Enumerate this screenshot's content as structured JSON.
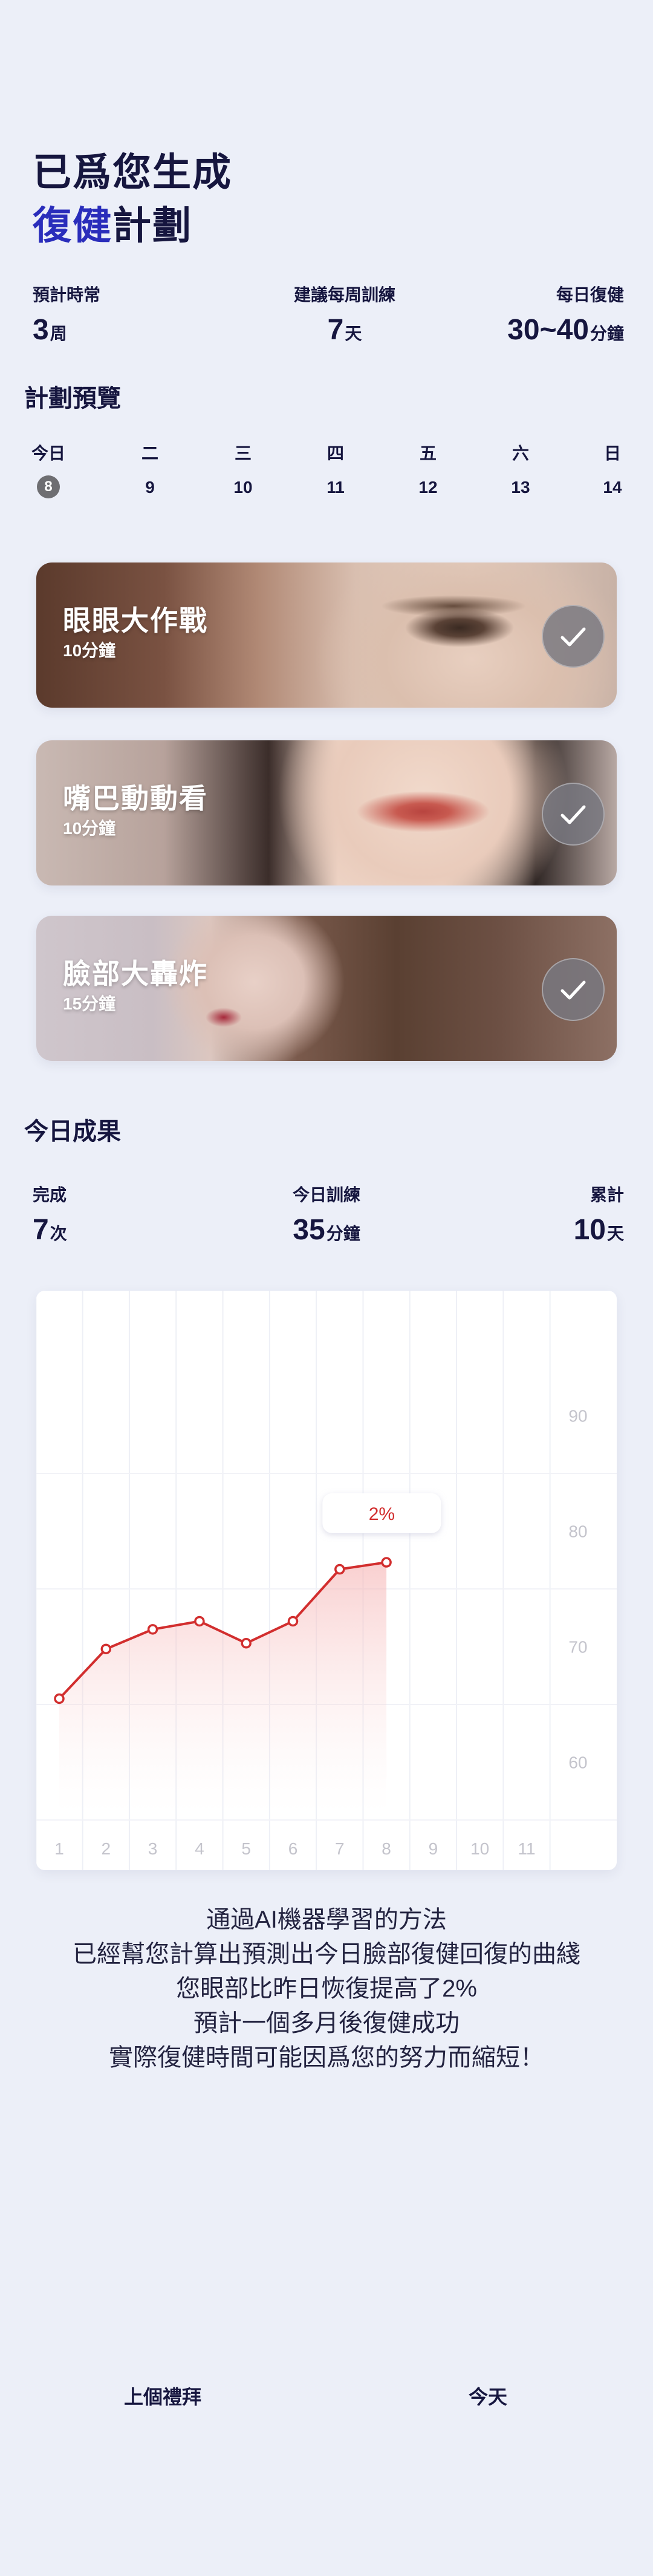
{
  "header": {
    "title_line1": "已爲您生成",
    "title_accent": "復健",
    "title_rest": "計劃"
  },
  "plan_stats": [
    {
      "label": "預計時常",
      "value": "3",
      "unit": "周"
    },
    {
      "label": "建議每周訓練",
      "value": "7",
      "unit": "天"
    },
    {
      "label": "每日復健",
      "value": "30~40",
      "unit": "分鐘"
    }
  ],
  "preview": {
    "title": "計劃預覽",
    "weekdays": [
      "今日",
      "二",
      "三",
      "四",
      "五",
      "六",
      "日"
    ],
    "days": [
      "8",
      "9",
      "10",
      "11",
      "12",
      "13",
      "14"
    ],
    "today_index": 0
  },
  "tasks": [
    {
      "title": "眼眼大作戰",
      "duration": "10分鐘",
      "checked": true,
      "icon": "check-icon"
    },
    {
      "title": "嘴巴動動看",
      "duration": "10分鐘",
      "checked": true,
      "icon": "check-icon"
    },
    {
      "title": "臉部大轟炸",
      "duration": "15分鐘",
      "checked": true,
      "icon": "check-icon"
    }
  ],
  "results": {
    "title": "今日成果",
    "stats": [
      {
        "label": "完成",
        "value": "7",
        "unit": "次"
      },
      {
        "label": "今日訓練",
        "value": "35",
        "unit": "分鐘"
      },
      {
        "label": "累計",
        "value": "10",
        "unit": "天"
      }
    ]
  },
  "chart_data": {
    "type": "line",
    "x": [
      1,
      2,
      3,
      4,
      5,
      6,
      7,
      8
    ],
    "x_ticks": [
      "1",
      "2",
      "3",
      "4",
      "5",
      "6",
      "7",
      "8",
      "9",
      "10",
      "11"
    ],
    "series": [
      {
        "values": [
          65.5,
          69.8,
          71.5,
          72.2,
          70.3,
          72.2,
          76.7,
          77.3
        ]
      }
    ],
    "y_ticks": [
      "60",
      "70",
      "80",
      "90"
    ],
    "ylim": [
      56,
      94
    ],
    "xlim": [
      1,
      11
    ],
    "annotation": "2%",
    "grid": true,
    "line_color": "#d22e2e"
  },
  "explanation": [
    "通過AI機器學習的方法",
    "已經幫您計算出預測出今日臉部復健回復的曲綫",
    "您眼部比昨日恢復提高了2%",
    "預計一個多月後復健成功",
    "實際復健時間可能因爲您的努力而縮短！"
  ],
  "footer": {
    "prev_week": "上個禮拜",
    "today": "今天"
  }
}
